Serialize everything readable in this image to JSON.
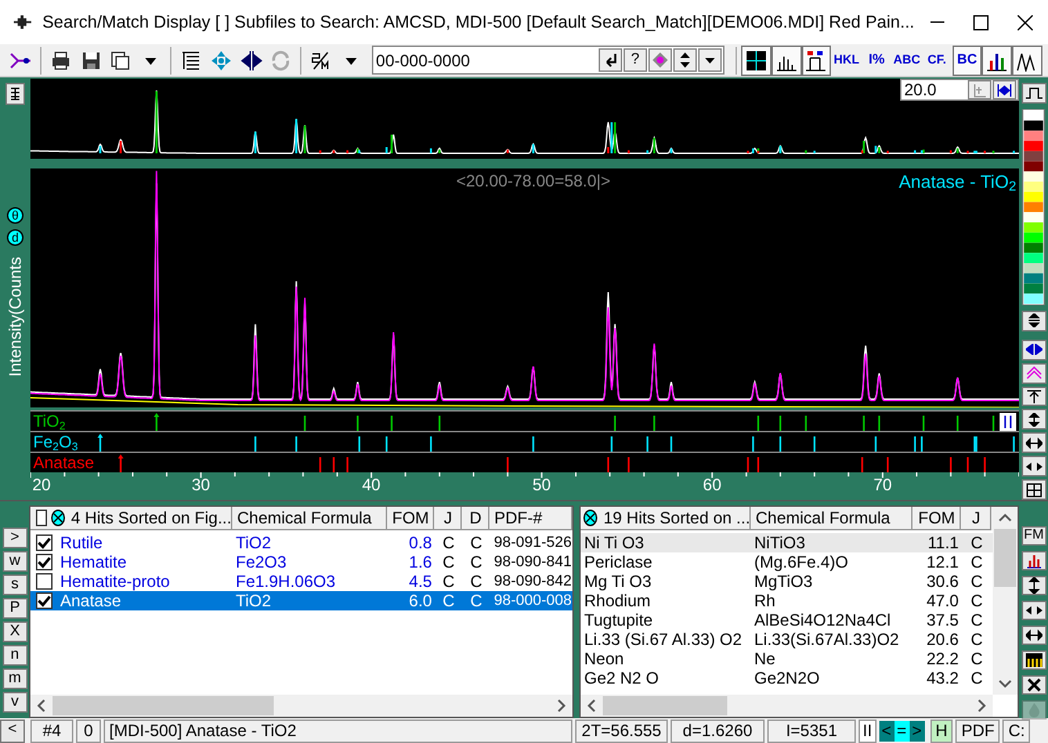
{
  "window": {
    "title": "Search/Match Display [ ] Subfiles to Search: AMCSD, MDI-500 [Default Search_Match][DEMO06.MDI] Red Pain..."
  },
  "toolbar": {
    "pdf_field": {
      "value": "00-000-0000"
    },
    "help_button": "?",
    "view_buttons": [
      {
        "kind": "grid",
        "selected": true
      },
      {
        "kind": "sticks",
        "selected": true
      },
      {
        "kind": "id",
        "selected": true
      },
      {
        "kind": "text",
        "label": "HKL",
        "selected": false
      },
      {
        "kind": "text",
        "label": "I%",
        "selected": false
      },
      {
        "kind": "text",
        "label": "ABC",
        "selected": false
      },
      {
        "kind": "text",
        "label": "CF.",
        "selected": false
      },
      {
        "kind": "text",
        "label": "BC",
        "selected": true
      },
      {
        "kind": "bars",
        "selected": true
      },
      {
        "kind": "peaks",
        "selected": true
      }
    ]
  },
  "chart": {
    "zoom_field": {
      "value": "20.0"
    },
    "range_label": "<20.00-78.00=58.0|>",
    "overlay_title": "Anatase - TiO$_{2}$",
    "y_label": "Intensity(Counts",
    "axis_buttons": [
      "θ",
      "d"
    ],
    "x_ticks": [
      "20",
      "30",
      "40",
      "50",
      "60",
      "70"
    ],
    "phases": [
      {
        "label": "TiO$_{2}$",
        "color": "#00c800"
      },
      {
        "label": "Fe$_{2}$O$_{3}$",
        "color": "#00e4ff"
      },
      {
        "label": "Anatase",
        "color": "#ff0000"
      }
    ]
  },
  "side_buttons": [
    ">",
    "w",
    "s",
    "P",
    "X",
    "n",
    "m",
    "v"
  ],
  "hits_table": {
    "header_checked": false,
    "title": "4 Hits Sorted on Fig...",
    "columns": [
      "Chemical Formula",
      "FOM",
      "J",
      "D",
      "PDF-#"
    ],
    "rows": [
      {
        "name": "Rutile",
        "formula": "TiO2",
        "fom": "0.8",
        "j": "C",
        "d": "C",
        "pdf": "98-091-526",
        "checked": true,
        "selected": false
      },
      {
        "name": "Hematite",
        "formula": "Fe2O3",
        "fom": "1.6",
        "j": "C",
        "d": "C",
        "pdf": "98-090-841",
        "checked": true,
        "selected": false
      },
      {
        "name": "Hematite-proto",
        "formula": "Fe1.9H.06O3",
        "fom": "4.5",
        "j": "C",
        "d": "C",
        "pdf": "98-090-842",
        "checked": false,
        "selected": false
      },
      {
        "name": "Anatase",
        "formula": "TiO2",
        "fom": "6.0",
        "j": "C",
        "d": "C",
        "pdf": "98-000-008",
        "checked": true,
        "selected": true
      }
    ]
  },
  "candidates_table": {
    "title": "19 Hits Sorted on ...",
    "columns": [
      "Chemical Formula",
      "FOM",
      "J"
    ],
    "rows": [
      {
        "name": "Ni Ti O3",
        "formula": "NiTiO3",
        "fom": "11.1",
        "j": "C",
        "selected": true
      },
      {
        "name": "Periclase",
        "formula": "(Mg.6Fe.4)O",
        "fom": "12.1",
        "j": "C",
        "selected": false
      },
      {
        "name": "Mg Ti O3",
        "formula": "MgTiO3",
        "fom": "30.6",
        "j": "C",
        "selected": false
      },
      {
        "name": "Rhodium",
        "formula": "Rh",
        "fom": "47.0",
        "j": "C",
        "selected": false
      },
      {
        "name": "Tugtupite",
        "formula": "AlBeSi4O12Na4Cl",
        "fom": "37.5",
        "j": "C",
        "selected": false
      },
      {
        "name": "Li.33 (Si.67 Al.33) O2",
        "formula": "Li.33(Si.67Al.33)O2",
        "fom": "20.6",
        "j": "C",
        "selected": false
      },
      {
        "name": "Neon",
        "formula": "Ne",
        "fom": "22.2",
        "j": "C",
        "selected": false
      },
      {
        "name": "Ge2 N2 O",
        "formula": "Ge2N2O",
        "fom": "43.2",
        "j": "C",
        "selected": false
      }
    ]
  },
  "right_buttons": [
    {
      "kind": "text",
      "label": "FM",
      "disabled": false
    },
    {
      "kind": "bars",
      "disabled": false
    },
    {
      "kind": "updown",
      "disabled": false
    },
    {
      "kind": "split",
      "disabled": false
    },
    {
      "kind": "leftright",
      "disabled": false
    },
    {
      "kind": "ruler",
      "disabled": false
    },
    {
      "kind": "close",
      "disabled": false
    },
    {
      "kind": "flame",
      "disabled": true
    }
  ],
  "status_bar": {
    "back_button": "<",
    "index": "#4",
    "count": "0",
    "message": "[MDI-500] Anatase - TiO2",
    "two_theta": "2T=56.555",
    "d_spacing": "d=1.6260",
    "intensity": "I=5351",
    "pause": "II",
    "nav": [
      {
        "label": "<",
        "selected": false
      },
      {
        "label": "=",
        "selected": true
      },
      {
        "label": ">",
        "selected": false
      }
    ],
    "h_button": "H",
    "pdf_button": "PDF",
    "drive": "C:"
  }
}
